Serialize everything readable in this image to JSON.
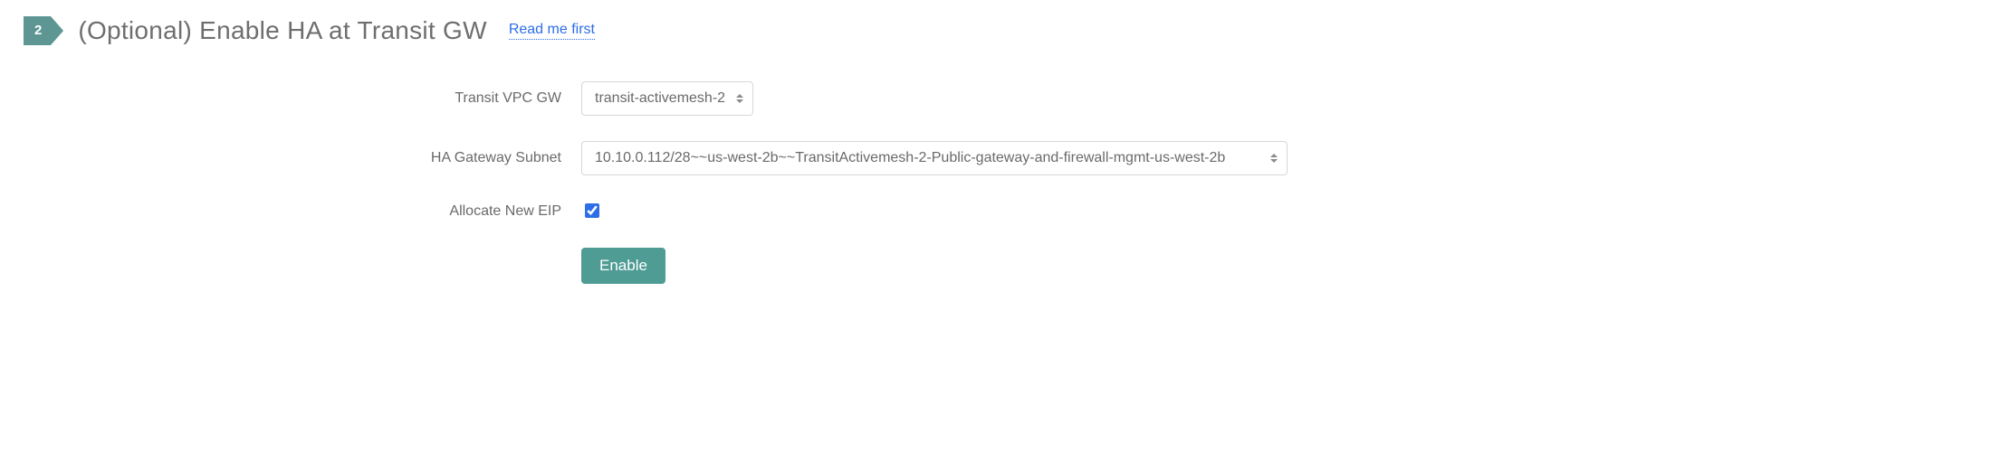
{
  "step": {
    "number": "2",
    "title": "(Optional) Enable HA at Transit GW",
    "readme_label": "Read me first"
  },
  "form": {
    "transit_vpc_gw": {
      "label": "Transit VPC GW",
      "selected": "transit-activemesh-2"
    },
    "ha_gateway_subnet": {
      "label": "HA Gateway Subnet",
      "selected": "10.10.0.112/28~~us-west-2b~~TransitActivemesh-2-Public-gateway-and-firewall-mgmt-us-west-2b"
    },
    "allocate_new_eip": {
      "label": "Allocate New EIP",
      "checked": true
    },
    "submit_label": "Enable"
  },
  "colors": {
    "accent": "#5d9693",
    "button": "#4e9c94",
    "link": "#2d6ee8"
  }
}
